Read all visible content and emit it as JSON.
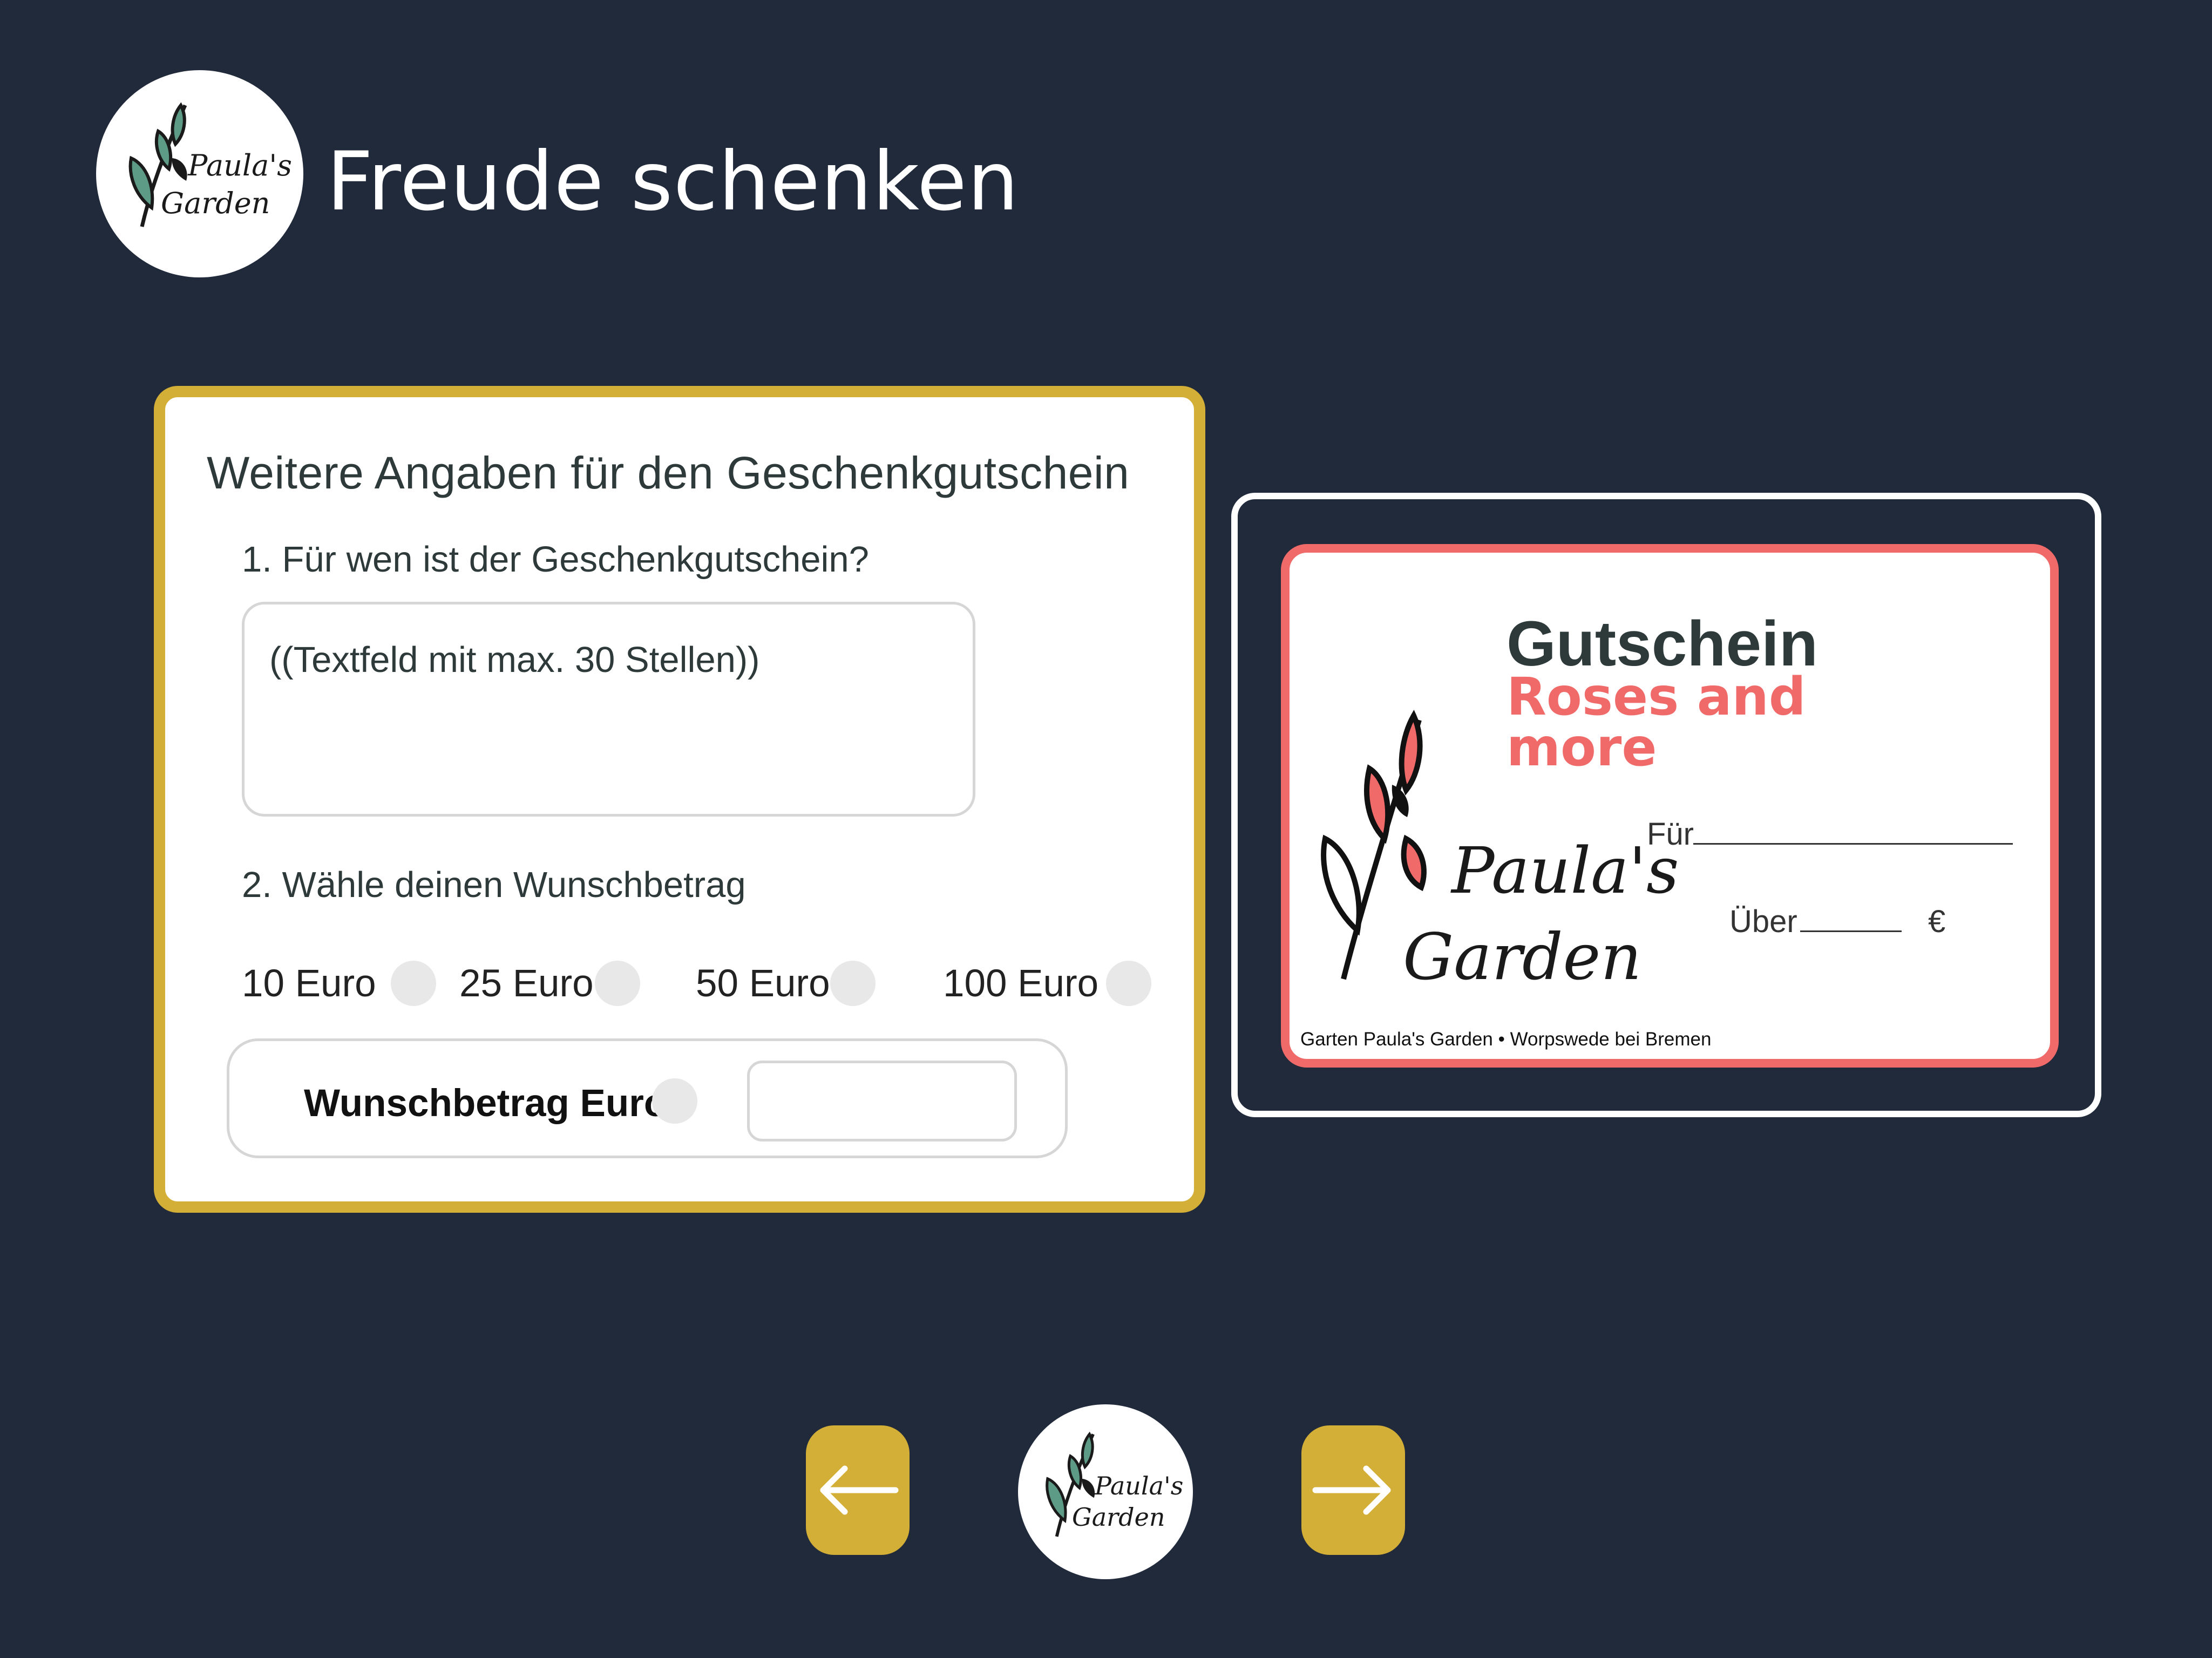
{
  "brand": {
    "line1": "Paula's",
    "line2": "Garden"
  },
  "header": {
    "title": "Freude schenken"
  },
  "form": {
    "title": "Weitere Angaben für den Geschenkgutschein",
    "question1": "1. Für wen ist der Geschenkgutschein?",
    "recipient_input_text": "((Textfeld mit max. 30 Stellen))",
    "question2": "2. Wähle deinen Wunschbetrag",
    "amount_options": [
      "10 Euro",
      "25 Euro",
      "50 Euro",
      "100 Euro"
    ],
    "custom_amount_label": "Wunschbetrag Euro"
  },
  "voucher": {
    "title": "Gutschein",
    "subtitle": "Roses and more",
    "for_label": "Für",
    "amount_label": "Über",
    "currency": "€",
    "footer": "Garten Paula's Garden • Worpswede bei Bremen"
  },
  "nav": {
    "back_icon": "arrow-left-icon",
    "next_icon": "arrow-right-icon"
  },
  "colors": {
    "background": "#212a3b",
    "accent": "#d4af37",
    "voucher_accent": "#f06a6a",
    "leaf_green": "#5e9b86"
  }
}
